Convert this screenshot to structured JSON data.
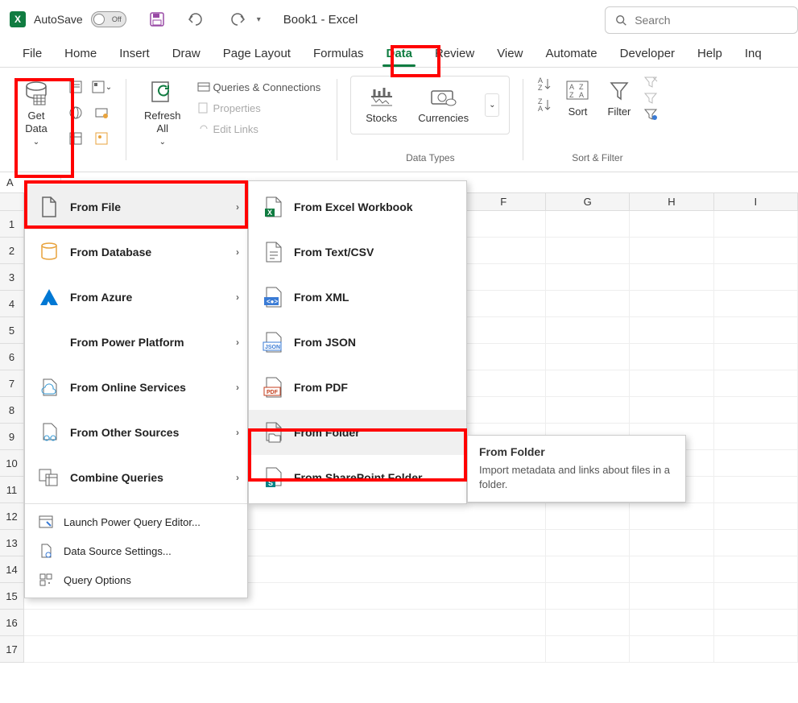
{
  "titlebar": {
    "autosave": "AutoSave",
    "toggle": "Off",
    "docTitle": "Book1  -  Excel",
    "searchPlaceholder": "Search"
  },
  "tabs": [
    "File",
    "Home",
    "Insert",
    "Draw",
    "Page Layout",
    "Formulas",
    "Data",
    "Review",
    "View",
    "Automate",
    "Developer",
    "Help",
    "Inq"
  ],
  "activeTab": "Data",
  "ribbon": {
    "getData": "Get\nData",
    "refreshAll": "Refresh\nAll",
    "queriesConns": "Queries & Connections",
    "properties": "Properties",
    "editLinks": "Edit Links",
    "stocks": "Stocks",
    "currencies": "Currencies",
    "dataTypesLabel": "Data Types",
    "sort": "Sort",
    "filter": "Filter",
    "sortFilterLabel": "Sort & Filter"
  },
  "nameBox": "A",
  "columns": [
    "F",
    "G",
    "H",
    "I"
  ],
  "rows": [
    1,
    2,
    3,
    4,
    5,
    6,
    7,
    8,
    9,
    10,
    11,
    12,
    13,
    14,
    15,
    16,
    17
  ],
  "menu1": [
    {
      "label": "From File",
      "kind": "bold",
      "arrow": true
    },
    {
      "label": "From Database",
      "kind": "bold",
      "arrow": true
    },
    {
      "label": "From Azure",
      "kind": "bold",
      "arrow": true
    },
    {
      "label": "From Power Platform",
      "kind": "bold",
      "arrow": true
    },
    {
      "label": "From Online Services",
      "kind": "bold",
      "arrow": true
    },
    {
      "label": "From Other Sources",
      "kind": "bold",
      "arrow": true
    },
    {
      "label": "Combine Queries",
      "kind": "bold",
      "arrow": true
    },
    {
      "label": "Launch Power Query Editor...",
      "kind": "small"
    },
    {
      "label": "Data Source Settings...",
      "kind": "small"
    },
    {
      "label": "Query Options",
      "kind": "small"
    }
  ],
  "menu2": [
    {
      "label": "From Excel Workbook"
    },
    {
      "label": "From Text/CSV"
    },
    {
      "label": "From XML"
    },
    {
      "label": "From JSON"
    },
    {
      "label": "From PDF"
    },
    {
      "label": "From Folder"
    },
    {
      "label": "From SharePoint Folder"
    }
  ],
  "tooltip": {
    "title": "From Folder",
    "body": "Import metadata and links about files in a folder."
  }
}
